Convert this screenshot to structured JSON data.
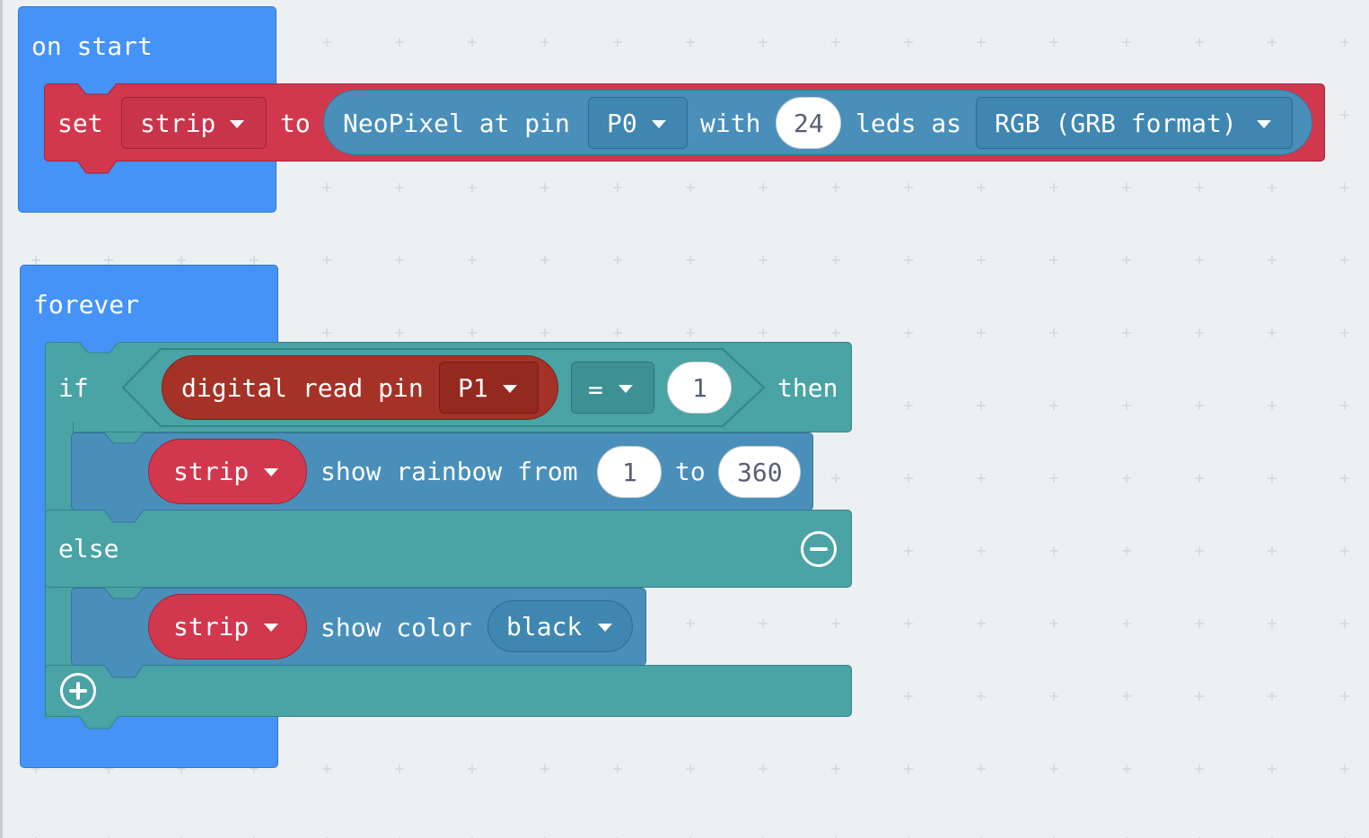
{
  "on_start": {
    "hat_label": "on start",
    "set_block": {
      "set_label": "set",
      "variable": "strip",
      "to_label": "to",
      "neopixel": {
        "label_at_pin": "NeoPixel at pin",
        "pin": "P0",
        "with_label": "with",
        "led_count": "24",
        "leds_as_label": "leds as",
        "mode": "RGB (GRB format)"
      }
    }
  },
  "forever": {
    "hat_label": "forever",
    "if_block": {
      "if_label": "if",
      "condition": {
        "digital_read_label": "digital read pin",
        "pin": "P1",
        "operator": "=",
        "compare_value": "1"
      },
      "then_label": "then",
      "then_branch": {
        "variable": "strip",
        "show_rainbow_label": "show rainbow from",
        "from_value": "1",
        "to_label": "to",
        "to_value": "360"
      },
      "else_label": "else",
      "else_branch": {
        "variable": "strip",
        "show_color_label": "show color",
        "color": "black"
      }
    }
  },
  "colors": {
    "events": "#4593f7",
    "variables": "#d1384d",
    "neopixel": "#4a8fba",
    "logic": "#4aa3a4",
    "pins": "#a53226",
    "workspace": "#ecf0f1"
  },
  "icons": {
    "remove_else": "minus-circle-icon",
    "add_else_if": "plus-circle-icon"
  }
}
